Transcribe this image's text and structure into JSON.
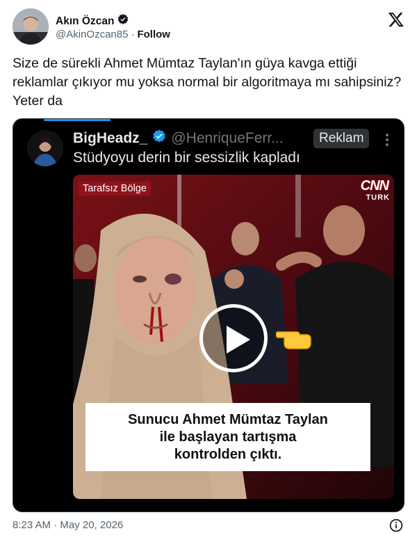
{
  "author": {
    "display_name": "Akın Özcan",
    "handle": "@AkinOzcan85",
    "separator": "·",
    "follow_label": "Follow"
  },
  "tweet": {
    "text": "Size de sürekli Ahmet Mümtaz Taylan'ın güya kavga ettiği reklamlar çıkıyor mu yoksa normal bir algoritmaya mı sahipsiniz? Yeter da",
    "timestamp": "8:23 AM · May 20, 2026"
  },
  "embedded": {
    "display_name": "BigHeadz_",
    "handle": "@HenriqueFerr...",
    "badge": "Reklam",
    "text": "Stüdyoyu derin bir sessizlik kapladı",
    "video": {
      "chyron": "Tarafsız Bölge",
      "logo_top": "CNN",
      "logo_bottom": "TURK",
      "caption_lines": [
        "Sunucu Ahmet Mümtaz Taylan",
        "ile başlayan tartışma",
        "kontrolden çıktı."
      ]
    }
  },
  "colors": {
    "verified_blue": "#1d9bf0",
    "text_primary": "#0f1419",
    "text_secondary": "#536471",
    "media_background": "#000000"
  },
  "icons": [
    "verified-badge-icon",
    "x-logo-icon",
    "more-icon",
    "play-icon",
    "pointing-hand-icon",
    "info-icon"
  ]
}
